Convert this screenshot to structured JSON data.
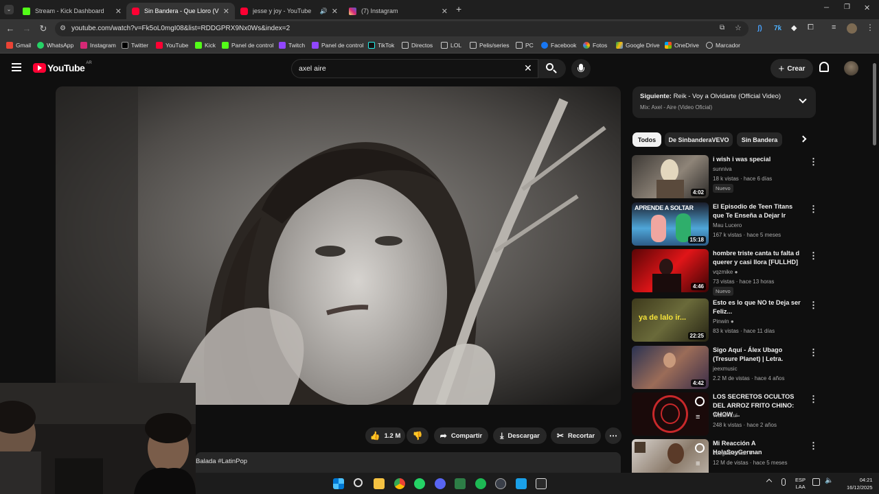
{
  "browser": {
    "tabs": [
      {
        "title": "Stream - Kick Dashboard",
        "active": false
      },
      {
        "title": "Sin Bandera - Que Lloro (Video Oficial)",
        "active": true
      },
      {
        "title": "jesse y joy - YouTube",
        "active": false
      },
      {
        "title": "(7) Instagram",
        "active": false
      }
    ],
    "url": "youtube.com/watch?v=Fk5oL0mgI08&list=RDDGPRX9Nx0Ws&index=2",
    "bookmarks": [
      "Gmail",
      "WhatsApp",
      "Instagram",
      "Twitter",
      "YouTube",
      "Kick",
      "Panel de control",
      "Twitch",
      "Panel de control",
      "TikTok",
      "Directos",
      "LOL",
      "Pelis/series",
      "PC",
      "Facebook",
      "Fotos",
      "Google Drive",
      "OneDrive",
      "Marcador"
    ]
  },
  "youtube": {
    "logo": "YouTube",
    "region": "AR",
    "search_query": "axel aire",
    "create_label": "Crear",
    "actions": {
      "likes": "1.2 M",
      "share": "Compartir",
      "download": "Descargar",
      "clip": "Recortar"
    },
    "description_snippet": "Balada #LatinPop",
    "playlist": {
      "next_prefix": "Siguiente:",
      "next_title": "Reik - Voy a Olvidarte (Official Video)",
      "mix": "Mix: Axel - Aire (Video Oficial)"
    },
    "chips": [
      "Todos",
      "De SinbanderaVEVO",
      "Sin Bandera"
    ],
    "recommendations": [
      {
        "title": "i wish i was special",
        "channel": "sunniva",
        "meta": "18 k vistas · hace 6 días",
        "duration": "4:02",
        "badge": "Nuevo",
        "verified": false
      },
      {
        "title": "El Episodio de Teen Titans que Te Enseña a Dejar Ir",
        "channel": "Mau Lucero",
        "meta": "167 k vistas · hace 5 meses",
        "duration": "15:18",
        "badge": "",
        "verified": false
      },
      {
        "title": "hombre triste canta tu falta d querer y casi llora [FULLHD]",
        "channel": "vqzmike",
        "meta": "73 vistas · hace 13 horas",
        "duration": "4:46",
        "badge": "Nuevo",
        "verified": true
      },
      {
        "title": "Esto es lo que NO te Deja ser Feliz...",
        "channel": "Pinwin",
        "meta": "83 k vistas · hace 11 días",
        "duration": "22:25",
        "badge": "",
        "verified": true
      },
      {
        "title": "Sigo Aquí - Álex Ubago (Tresure Planet) | Letra.",
        "channel": "jeexmusic",
        "meta": "2.2 M de vistas · hace 4 años",
        "duration": "4:42",
        "badge": "",
        "verified": false
      },
      {
        "title": "LOS SECRETOS OCULTOS DEL ARROZ FRITO CHINO: CHOW ...",
        "channel": "Walter Lui",
        "meta": "248 k vistas · hace 2 años",
        "duration": "",
        "badge": "",
        "verified": false
      },
      {
        "title": "Mi Reacción A HolaSoyGerman",
        "channel": "JuegaGerman",
        "meta": "12 M de vistas · hace 5 meses",
        "duration": "",
        "badge": "",
        "verified": true
      }
    ],
    "thumb_texts": [
      "APRENDE A SOLTAR",
      "ya de lalo ir..."
    ]
  },
  "taskbar": {
    "lang": "ESP",
    "layout": "LAA",
    "time": "04:21",
    "date": "16/12/2025"
  }
}
